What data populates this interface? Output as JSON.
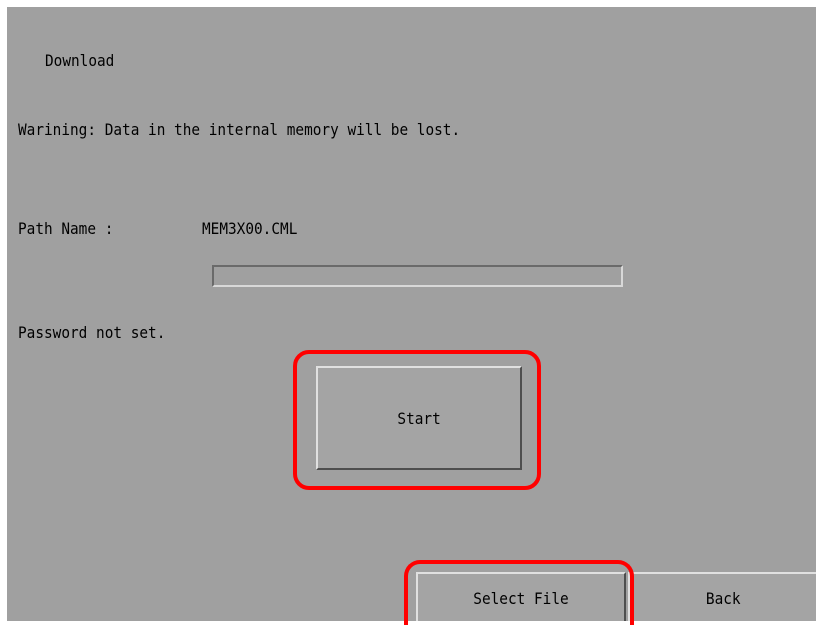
{
  "screen": {
    "title": "Download",
    "warning": "Warining: Data in the internal memory will be lost.",
    "path_label": "Path Name :",
    "path_value": "MEM3X00.CML",
    "download_progress": 0,
    "password_status": "Password not set."
  },
  "buttons": {
    "start_label": "Start",
    "select_file_label": "Select File",
    "back_label": "Back"
  },
  "colors": {
    "screen_background": "#a0a0a0",
    "highlight": "#ff0000"
  }
}
